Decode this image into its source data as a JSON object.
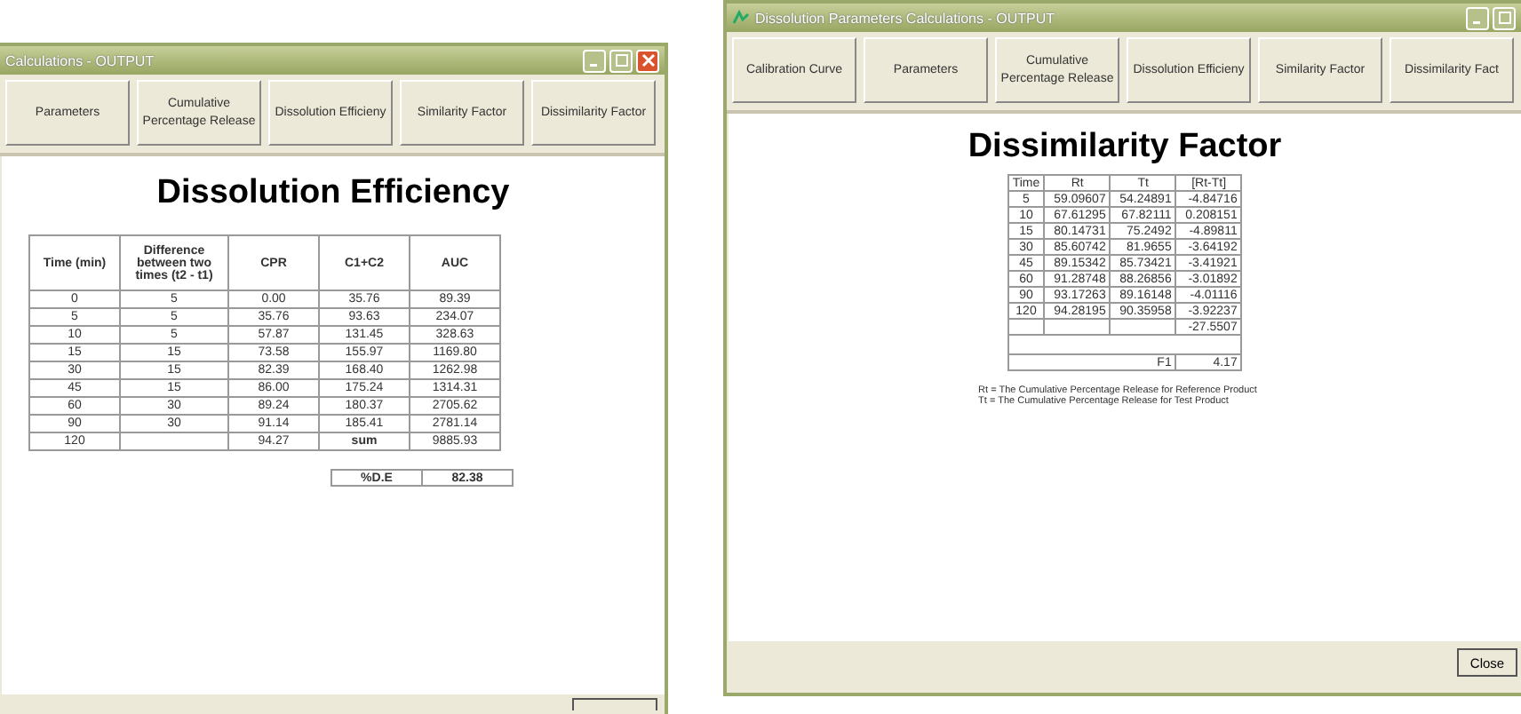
{
  "windows": [
    {
      "kind": "efficiency",
      "title": "Calculations - OUTPUT",
      "title_buttons": [
        {
          "kind": "minimize"
        },
        {
          "kind": "maximize"
        },
        {
          "kind": "close"
        }
      ],
      "tabs": [
        "Parameters",
        "Cumulative Percentage Release",
        "Dissolution Efficieny",
        "Similarity Factor",
        "Dissimilarity Factor"
      ],
      "heading": "Dissolution Efficiency",
      "columns": [
        "Time (min)",
        "Difference between two times (t2 - t1)",
        "CPR",
        "C1+C2",
        "AUC"
      ],
      "rows": [
        {
          "cells": [
            "0",
            "5",
            "0.00",
            "35.76",
            "89.39"
          ]
        },
        {
          "cells": [
            "5",
            "5",
            "35.76",
            "93.63",
            "234.07"
          ]
        },
        {
          "cells": [
            "10",
            "5",
            "57.87",
            "131.45",
            "328.63"
          ]
        },
        {
          "cells": [
            "15",
            "15",
            "73.58",
            "155.97",
            "1169.80"
          ]
        },
        {
          "cells": [
            "30",
            "15",
            "82.39",
            "168.40",
            "1262.98"
          ]
        },
        {
          "cells": [
            "45",
            "15",
            "86.00",
            "175.24",
            "1314.31"
          ]
        },
        {
          "cells": [
            "60",
            "30",
            "89.24",
            "180.37",
            "2705.62"
          ]
        },
        {
          "cells": [
            "90",
            "30",
            "91.14",
            "185.41",
            "2781.14"
          ]
        },
        {
          "cells": [
            "120",
            "",
            "94.27",
            {
              "text": "sum",
              "bold": true
            },
            "9885.93"
          ]
        }
      ],
      "result": {
        "label": "%D.E",
        "value": "82.38"
      }
    },
    {
      "kind": "dissimilarity",
      "title": "Dissolution Parameters Calculations - OUTPUT",
      "title_buttons": [
        {
          "kind": "minimize"
        },
        {
          "kind": "maximize"
        }
      ],
      "tabs": [
        "Calibration Curve",
        "Parameters",
        "Cumulative Percentage Release",
        "Dissolution Efficieny",
        "Similarity Factor",
        "Dissimilarity Fact"
      ],
      "heading": "Dissimilarity Factor",
      "columns": [
        "Time",
        "Rt",
        "Tt",
        "[Rt-Tt]"
      ],
      "rows": [
        {
          "cells": [
            "5",
            "59.09607",
            "54.24891",
            "-4.84716"
          ]
        },
        {
          "cells": [
            "10",
            "67.61295",
            "67.82111",
            "0.208151"
          ]
        },
        {
          "cells": [
            "15",
            "80.14731",
            "75.2492",
            "-4.89811"
          ]
        },
        {
          "cells": [
            "30",
            "85.60742",
            "81.9655",
            "-3.64192"
          ]
        },
        {
          "cells": [
            "45",
            "89.15342",
            "85.73421",
            "-3.41921"
          ]
        },
        {
          "cells": [
            "60",
            "91.28748",
            "88.26856",
            "-3.01892"
          ]
        },
        {
          "cells": [
            "90",
            "93.17263",
            "89.16148",
            "-4.01116"
          ]
        },
        {
          "cells": [
            "120",
            "94.28195",
            "90.35958",
            "-3.92237"
          ]
        }
      ],
      "sum": "-27.5507",
      "result": {
        "label": "F1",
        "value": "4.17"
      },
      "notes": [
        "Rt = The Cumulative Percentage Release for Reference Product",
        "Tt = The Cumulative Percentage Release for Test Product"
      ],
      "footer": {
        "button_label": "Close"
      }
    }
  ]
}
